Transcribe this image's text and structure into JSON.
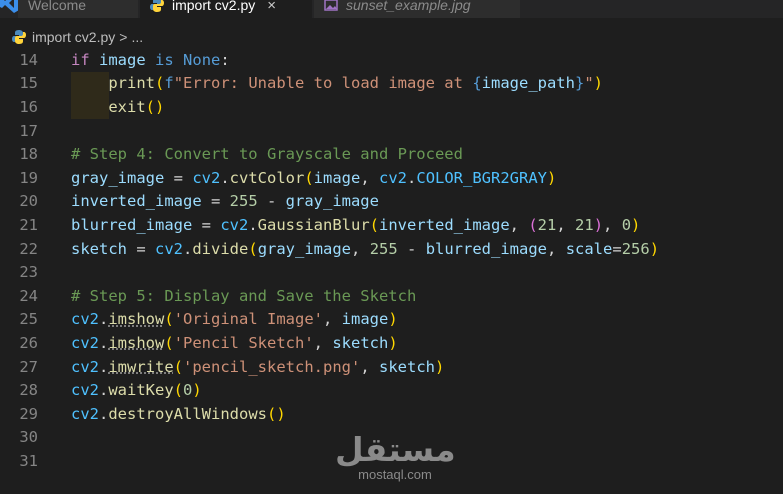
{
  "tabs": [
    {
      "label": "Welcome",
      "icon": "vscode-icon",
      "active": false
    },
    {
      "label": "import cv2.py",
      "icon": "python-icon",
      "active": true,
      "close": "×"
    },
    {
      "label": "sunset_example.jpg",
      "icon": "image-icon",
      "active": false
    }
  ],
  "breadcrumb": {
    "file": "import cv2.py",
    "separator": ">",
    "more": "..."
  },
  "colors": {
    "keyword": "#569cd6",
    "control": "#c586c0",
    "function": "#dcdcaa",
    "variable": "#9cdcfe",
    "string": "#ce9178",
    "number": "#b5cea8",
    "comment": "#6a9955",
    "constant": "#4fc1ff",
    "background": "#1e1e1e"
  },
  "lines": [
    {
      "n": "14",
      "tokens": [
        [
          "ctl",
          "if"
        ],
        [
          "txt",
          " "
        ],
        [
          "var",
          "image"
        ],
        [
          "txt",
          " "
        ],
        [
          "kw",
          "is"
        ],
        [
          "txt",
          " "
        ],
        [
          "kw",
          "None"
        ],
        [
          "txt",
          ":"
        ]
      ]
    },
    {
      "n": "15",
      "tokens": [
        [
          "txt",
          "    "
        ],
        [
          "fn",
          "print"
        ],
        [
          "br1",
          "("
        ],
        [
          "kw",
          "f"
        ],
        [
          "str",
          "\"Error: Unable to load image at "
        ],
        [
          "kw",
          "{"
        ],
        [
          "var",
          "image_path"
        ],
        [
          "kw",
          "}"
        ],
        [
          "str",
          "\""
        ],
        [
          "br1",
          ")"
        ]
      ]
    },
    {
      "n": "16",
      "tokens": [
        [
          "txt",
          "    "
        ],
        [
          "fn",
          "exit"
        ],
        [
          "br1",
          "()"
        ]
      ]
    },
    {
      "n": "17",
      "tokens": []
    },
    {
      "n": "18",
      "tokens": [
        [
          "cmt",
          "# Step 4: Convert to Grayscale and Proceed"
        ]
      ]
    },
    {
      "n": "19",
      "tokens": [
        [
          "var",
          "gray_image"
        ],
        [
          "txt",
          " = "
        ],
        [
          "const",
          "cv2"
        ],
        [
          "txt",
          "."
        ],
        [
          "fn",
          "cvtColor"
        ],
        [
          "br1",
          "("
        ],
        [
          "var",
          "image"
        ],
        [
          "txt",
          ", "
        ],
        [
          "const",
          "cv2"
        ],
        [
          "txt",
          "."
        ],
        [
          "const",
          "COLOR_BGR2GRAY"
        ],
        [
          "br1",
          ")"
        ]
      ]
    },
    {
      "n": "20",
      "tokens": [
        [
          "var",
          "inverted_image"
        ],
        [
          "txt",
          " = "
        ],
        [
          "num",
          "255"
        ],
        [
          "txt",
          " - "
        ],
        [
          "var",
          "gray_image"
        ]
      ]
    },
    {
      "n": "21",
      "tokens": [
        [
          "var",
          "blurred_image"
        ],
        [
          "txt",
          " = "
        ],
        [
          "const",
          "cv2"
        ],
        [
          "txt",
          "."
        ],
        [
          "fn",
          "GaussianBlur"
        ],
        [
          "br1",
          "("
        ],
        [
          "var",
          "inverted_image"
        ],
        [
          "txt",
          ", "
        ],
        [
          "br2",
          "("
        ],
        [
          "num",
          "21"
        ],
        [
          "txt",
          ", "
        ],
        [
          "num",
          "21"
        ],
        [
          "br2",
          ")"
        ],
        [
          "txt",
          ", "
        ],
        [
          "num",
          "0"
        ],
        [
          "br1",
          ")"
        ]
      ]
    },
    {
      "n": "22",
      "tokens": [
        [
          "var",
          "sketch"
        ],
        [
          "txt",
          " = "
        ],
        [
          "const",
          "cv2"
        ],
        [
          "txt",
          "."
        ],
        [
          "fn",
          "divide"
        ],
        [
          "br1",
          "("
        ],
        [
          "var",
          "gray_image"
        ],
        [
          "txt",
          ", "
        ],
        [
          "num",
          "255"
        ],
        [
          "txt",
          " - "
        ],
        [
          "var",
          "blurred_image"
        ],
        [
          "txt",
          ", "
        ],
        [
          "var",
          "scale"
        ],
        [
          "txt",
          "="
        ],
        [
          "num",
          "256"
        ],
        [
          "br1",
          ")"
        ]
      ]
    },
    {
      "n": "23",
      "tokens": []
    },
    {
      "n": "24",
      "tokens": [
        [
          "cmt",
          "# Step 5: Display and Save the Sketch"
        ]
      ]
    },
    {
      "n": "25",
      "tokens": [
        [
          "const",
          "cv2"
        ],
        [
          "txt",
          "."
        ],
        [
          "fnd",
          "imshow"
        ],
        [
          "br1",
          "("
        ],
        [
          "str",
          "'Original Image'"
        ],
        [
          "txt",
          ", "
        ],
        [
          "var",
          "image"
        ],
        [
          "br1",
          ")"
        ]
      ]
    },
    {
      "n": "26",
      "tokens": [
        [
          "const",
          "cv2"
        ],
        [
          "txt",
          "."
        ],
        [
          "fnd",
          "imshow"
        ],
        [
          "br1",
          "("
        ],
        [
          "str",
          "'Pencil Sketch'"
        ],
        [
          "txt",
          ", "
        ],
        [
          "var",
          "sketch"
        ],
        [
          "br1",
          ")"
        ]
      ]
    },
    {
      "n": "27",
      "tokens": [
        [
          "const",
          "cv2"
        ],
        [
          "txt",
          "."
        ],
        [
          "fnd",
          "imwrite"
        ],
        [
          "br1",
          "("
        ],
        [
          "str",
          "'pencil_sketch.png'"
        ],
        [
          "txt",
          ", "
        ],
        [
          "var",
          "sketch"
        ],
        [
          "br1",
          ")"
        ]
      ]
    },
    {
      "n": "28",
      "tokens": [
        [
          "const",
          "cv2"
        ],
        [
          "txt",
          "."
        ],
        [
          "fn",
          "waitKey"
        ],
        [
          "br1",
          "("
        ],
        [
          "num",
          "0"
        ],
        [
          "br1",
          ")"
        ]
      ]
    },
    {
      "n": "29",
      "tokens": [
        [
          "const",
          "cv2"
        ],
        [
          "txt",
          "."
        ],
        [
          "fn",
          "destroyAllWindows"
        ],
        [
          "br1",
          "()"
        ]
      ]
    },
    {
      "n": "30",
      "tokens": []
    },
    {
      "n": "31",
      "tokens": []
    }
  ],
  "watermark": {
    "arabic": "مستقل",
    "latin": "mostaql.com"
  }
}
